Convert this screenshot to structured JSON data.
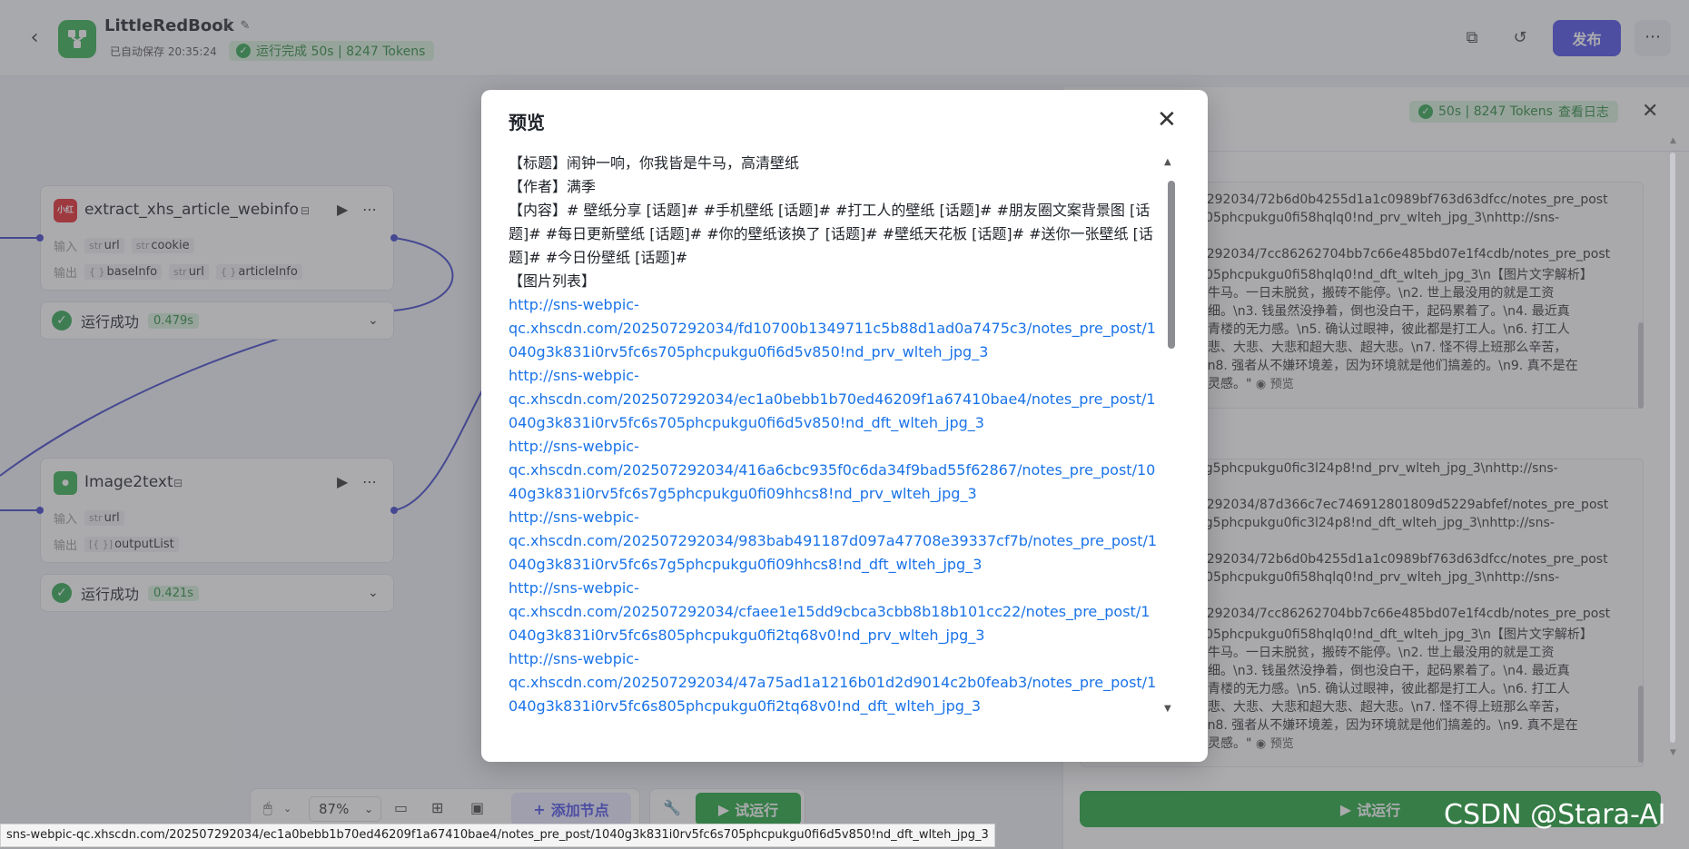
{
  "header": {
    "app_title": "LittleRedBook",
    "save_text": "已自动保存 20:35:24",
    "run_status": "运行完成 50s | 8247 Tokens",
    "publish_label": "发布"
  },
  "nodes": [
    {
      "title": "extract_xhs_article_webinfo",
      "icon_text": "小红书",
      "input_label": "输入",
      "inputs": [
        {
          "type": "str",
          "name": "url"
        },
        {
          "type": "str",
          "name": "cookie"
        }
      ],
      "output_label": "输出",
      "outputs": [
        {
          "type": "{ }",
          "name": "baseInfo"
        },
        {
          "type": "str",
          "name": "url"
        },
        {
          "type": "{ }",
          "name": "articleInfo"
        }
      ],
      "status": "运行成功",
      "time": "0.479s"
    },
    {
      "title": "Image2text",
      "input_label": "输入",
      "inputs": [
        {
          "type": "str",
          "name": "url"
        }
      ],
      "output_label": "输出",
      "outputs": [
        {
          "type": "[{ }]",
          "name": "outputList"
        }
      ],
      "status": "运行成功",
      "time": "0.421s"
    }
  ],
  "right_panel": {
    "status_badge": "50s | 8247 Tokens",
    "log_link": "查看日志",
    "box1_lines": [
      "507292034/72b6d0b4255d1a1c0989bf763d63dfcc/notes_pre_post",
      "6sb05phcpukgu0fi58hqlq0!nd_prv_wlteh_jpg_3\\nhttp://sns-",
      "507292034/7cc86262704bb7c66e485bd07e1f4cdb/notes_pre_post",
      "6sb05phcpukgu0fi58hqlq0!nd_dft_wlteh_jpg_3\\n【图片文字解析】",
      "皆是牛马。一日未脱贫，搬砖不能停。\\n2. 世上最没用的就是工资",
      "股太细。\\n3. 钱虽然没挣着，倒也没白干，起码累着了。\\n4. 最近真",
      "监进青楼的无力感。\\n5. 确认过眼神，彼此都是打工人。\\n6. 打工人",
      "有中悲、大悲、大悲和超大悲、超大悲。\\n7. 怪不得上班那么辛苦，",
      "3。\\n8. 强者从不嫌环境差，因为环境就是他们搞差的。\\n9. 真不是在",
      "找找灵感。\""
    ],
    "box2_lines": [
      "6sag5phcpukgu0fic3l24p8!nd_prv_wlteh_jpg_3\\nhttp://sns-",
      "507292034/87d366c7ec746912801809d5229abfef/notes_pre_post",
      "6sag5phcpukgu0fic3l24p8!nd_dft_wlteh_jpg_3\\nhttp://sns-",
      "507292034/72b6d0b4255d1a1c0989bf763d63dfcc/notes_pre_post",
      "6sb05phcpukgu0fi58hqlq0!nd_prv_wlteh_jpg_3\\nhttp://sns-",
      "507292034/7cc86262704bb7c66e485bd07e1f4cdb/notes_pre_post",
      "6sb05phcpukgu0fi58hqlq0!nd_dft_wlteh_jpg_3\\n【图片文字解析】",
      "皆是牛马。一日未脱贫，搬砖不能停。\\n2. 世上最没用的就是工资",
      "股太细。\\n3. 钱虽然没挣着，倒也没白干，起码累着了。\\n4. 最近真",
      "监进青楼的无力感。\\n5. 确认过眼神，彼此都是打工人。\\n6. 打工人",
      "有中悲、大悲、大悲和超大悲、超大悲。\\n7. 怪不得上班那么辛苦，",
      "3。\\n8. 强者从不嫌环境差，因为环境就是他们搞差的。\\n9. 真不是在",
      "找找灵感。\""
    ],
    "preview_label": "预览",
    "run_label": "试运行"
  },
  "toolbar": {
    "zoom": "87%",
    "add_node_label": "添加节点",
    "try_run_label": "试运行"
  },
  "modal": {
    "title": "预览",
    "lines": [
      {
        "text": "【标题】闹钟一响，你我皆是牛马，高清壁纸",
        "link": false
      },
      {
        "text": "【作者】满季",
        "link": false
      },
      {
        "text": "【内容】# 壁纸分享 [话题]# #手机壁纸 [话题]# #打工人的壁纸 [话题]# #朋友圈文案背景图 [话",
        "link": false
      },
      {
        "text": "题]# #每日更新壁纸 [话题]# #你的壁纸该换了 [话题]# #壁纸天花板 [话题]# #送你一张壁纸 [话",
        "link": false
      },
      {
        "text": "题]# #今日份壁纸 [话题]#",
        "link": false
      },
      {
        "text": "【图片列表】",
        "link": false
      },
      {
        "text": "http://sns-webpic-",
        "link": true
      },
      {
        "text": "qc.xhscdn.com/202507292034/fd10700b1349711c5b88d1ad0a7475c3/notes_pre_post/1",
        "link": true
      },
      {
        "text": "040g3k831i0rv5fc6s705phcpukgu0fi6d5v850!nd_prv_wlteh_jpg_3",
        "link": true
      },
      {
        "text": "http://sns-webpic-",
        "link": true
      },
      {
        "text": "qc.xhscdn.com/202507292034/ec1a0bebb1b70ed46209f1a67410bae4/notes_pre_post/1",
        "link": true
      },
      {
        "text": "040g3k831i0rv5fc6s705phcpukgu0fi6d5v850!nd_dft_wlteh_jpg_3",
        "link": true
      },
      {
        "text": "http://sns-webpic-",
        "link": true
      },
      {
        "text": "qc.xhscdn.com/202507292034/416a6cbc935f0c6da34f9bad55f62867/notes_pre_post/10",
        "link": true
      },
      {
        "text": "40g3k831i0rv5fc6s7g5phcpukgu0fi09hhcs8!nd_prv_wlteh_jpg_3",
        "link": true
      },
      {
        "text": "http://sns-webpic-",
        "link": true
      },
      {
        "text": "qc.xhscdn.com/202507292034/983bab491187d097a47708e39337cf7b/notes_pre_post/1",
        "link": true
      },
      {
        "text": "040g3k831i0rv5fc6s7g5phcpukgu0fi09hhcs8!nd_dft_wlteh_jpg_3",
        "link": true
      },
      {
        "text": "http://sns-webpic-",
        "link": true
      },
      {
        "text": "qc.xhscdn.com/202507292034/cfaee1e15dd9cbca3cbb8b18b101cc22/notes_pre_post/1",
        "link": true
      },
      {
        "text": "040g3k831i0rv5fc6s805phcpukgu0fi2tq68v0!nd_prv_wlteh_jpg_3",
        "link": true
      },
      {
        "text": "http://sns-webpic-",
        "link": true
      },
      {
        "text": "qc.xhscdn.com/202507292034/47a75ad1a1216b01d2d9014c2b0feab3/notes_pre_post/1",
        "link": true
      },
      {
        "text": "040g3k831i0rv5fc6s805phcpukgu0fi2tq68v0!nd_dft_wlteh_jpg_3",
        "link": true
      }
    ]
  },
  "status_url": "sns-webpic-qc.xhscdn.com/202507292034/ec1a0bebb1b70ed46209f1a67410bae4/notes_pre_post/1040g3k831i0rv5fc6s705phcpukgu0fi6d5v850!nd_dft_wlteh_jpg_3",
  "watermark": "CSDN @Stara-AI",
  "colors": {
    "accent": "#4b4de8",
    "success": "#2fa84f",
    "link": "#1a73e8"
  }
}
